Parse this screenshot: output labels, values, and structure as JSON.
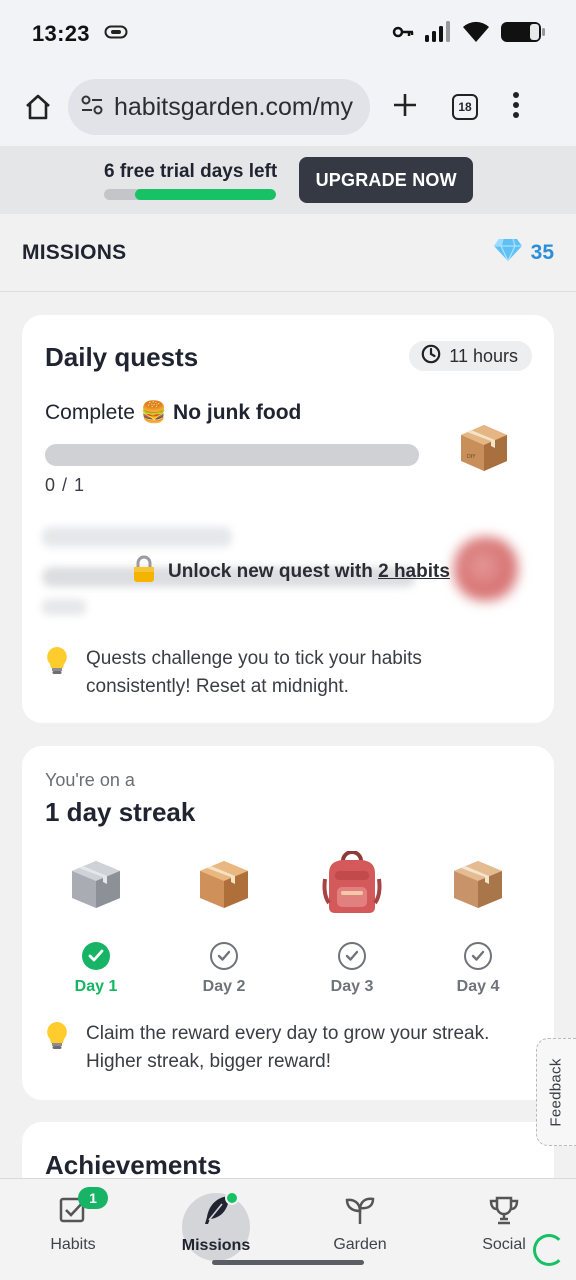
{
  "status_bar": {
    "time": "13:23"
  },
  "browser": {
    "url": "habitsgarden.com/my",
    "tab_count": "18"
  },
  "trial": {
    "text": "6 free trial days left",
    "progress": 0.82,
    "upgrade_label": "UPGRADE NOW"
  },
  "header": {
    "title": "MISSIONS",
    "gems": "35"
  },
  "daily_quests": {
    "title": "Daily quests",
    "timer": "11 hours",
    "quest": {
      "prefix": "Complete",
      "emoji": "🍔",
      "name": "No junk food",
      "progress": "0 / 1"
    },
    "locked": {
      "text": "Unlock new quest with",
      "link": "2 habits"
    },
    "tip": "Quests challenge you to tick your habits consistently! Reset at midnight."
  },
  "streak": {
    "subtitle": "You're on a",
    "title": "1 day streak",
    "days": [
      {
        "label": "Day 1",
        "completed": true
      },
      {
        "label": "Day 2",
        "completed": false
      },
      {
        "label": "Day 3",
        "completed": false
      },
      {
        "label": "Day 4",
        "completed": false
      }
    ],
    "tip": "Claim the reward every day to grow your streak. Higher streak, bigger reward!"
  },
  "achievements": {
    "title": "Achievements"
  },
  "feedback": {
    "label": "Feedback"
  },
  "nav": {
    "items": [
      {
        "label": "Habits",
        "badge": "1"
      },
      {
        "label": "Missions"
      },
      {
        "label": "Garden"
      },
      {
        "label": "Social"
      }
    ]
  },
  "colors": {
    "accent_green": "#16c265",
    "gem_blue": "#2a8fd8",
    "upgrade_bg": "#343944"
  }
}
